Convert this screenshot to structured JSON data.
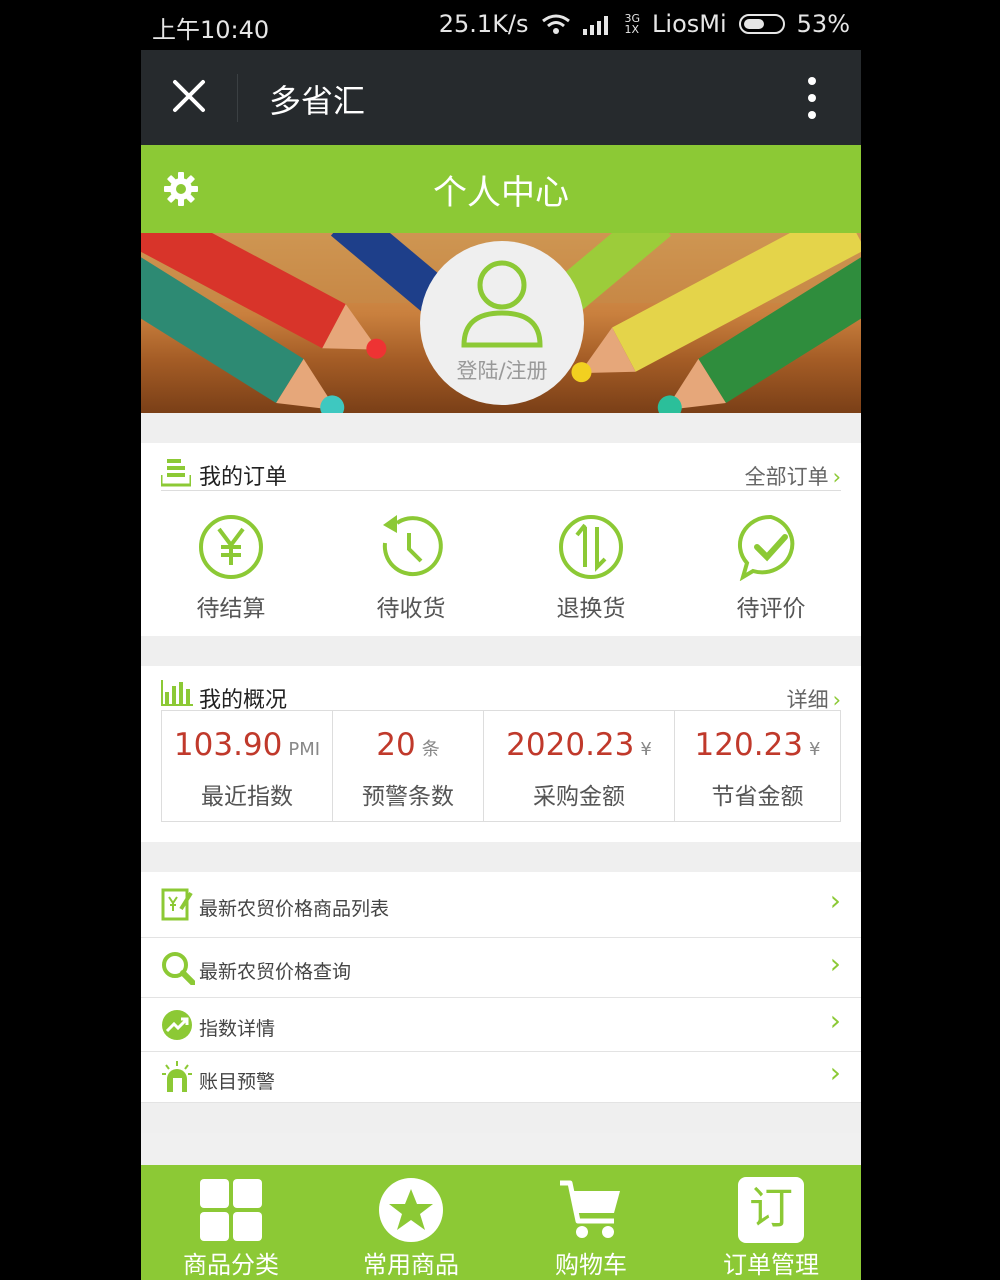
{
  "status_bar": {
    "time": "上午10:40",
    "speed": "25.1K/s",
    "net_type_top": "3G",
    "net_type_bottom": "1X",
    "carrier": "LiosMi",
    "battery": "53%"
  },
  "topbar": {
    "title": "多省汇"
  },
  "header": {
    "title": "个人中心"
  },
  "profile": {
    "login_label": "登陆/注册"
  },
  "orders": {
    "title": "我的订单",
    "all_label": "全部订单",
    "items": [
      {
        "label": "待结算",
        "icon": "yen-icon"
      },
      {
        "label": "待收货",
        "icon": "clock-icon"
      },
      {
        "label": "退换货",
        "icon": "exchange-icon"
      },
      {
        "label": "待评价",
        "icon": "comment-check-icon"
      }
    ]
  },
  "overview": {
    "title": "我的概况",
    "detail_label": "详细",
    "stats": [
      {
        "value": "103.90",
        "unit": "PMI",
        "label": "最近指数"
      },
      {
        "value": "20",
        "unit": "条",
        "label": "预警条数"
      },
      {
        "value": "2020.23",
        "unit": "¥",
        "label": "采购金额"
      },
      {
        "value": "120.23",
        "unit": "¥",
        "label": "节省金额"
      }
    ]
  },
  "menu": [
    {
      "label": "最新农贸价格商品列表",
      "icon": "price-list-icon"
    },
    {
      "label": "最新农贸价格查询",
      "icon": "search-icon"
    },
    {
      "label": "指数详情",
      "icon": "trend-icon"
    },
    {
      "label": "账目预警",
      "icon": "alarm-icon"
    }
  ],
  "tabbar": [
    {
      "label": "商品分类",
      "icon": "grid-icon"
    },
    {
      "label": "常用商品",
      "icon": "star-icon"
    },
    {
      "label": "购物车",
      "icon": "cart-icon"
    },
    {
      "label": "订单管理",
      "icon": "order-icon",
      "glyph": "订"
    }
  ],
  "colors": {
    "accent": "#8cc935",
    "topbar": "#262a2d",
    "value_red": "#c0392b"
  }
}
